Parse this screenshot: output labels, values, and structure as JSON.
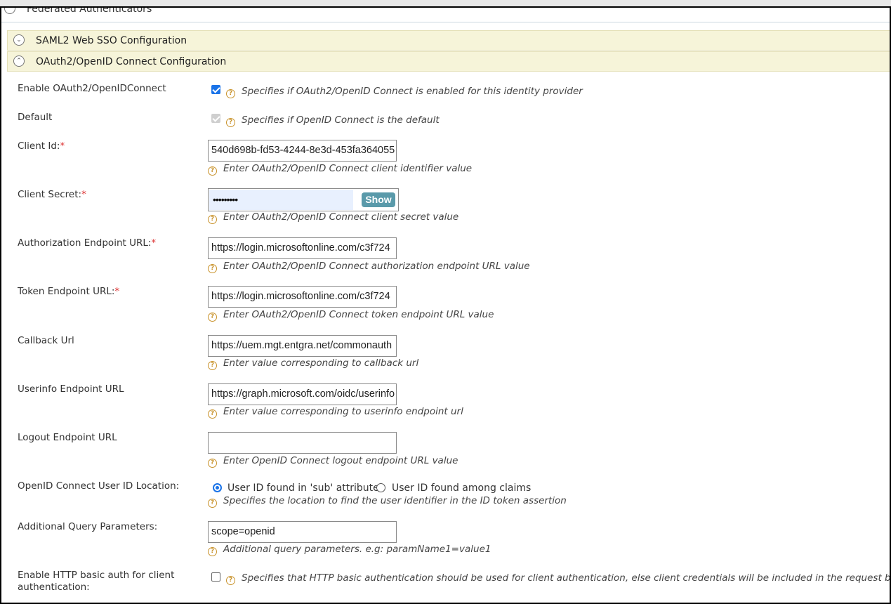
{
  "federated": {
    "title": "Federated Authenticators"
  },
  "sections": {
    "saml": "SAML2 Web SSO Configuration",
    "oauth": "OAuth2/OpenID Connect Configuration"
  },
  "required_marker": "*",
  "fields": {
    "enable": {
      "label": "Enable OAuth2/OpenIDConnect",
      "checked": true,
      "hint": "Specifies if OAuth2/OpenID Connect is enabled for this identity provider"
    },
    "default": {
      "label": "Default",
      "checked": true,
      "disabled": true,
      "hint": "Specifies if OpenID Connect is the default"
    },
    "client_id": {
      "label": "Client Id:",
      "value": "540d698b-fd53-4244-8e3d-453fa364055",
      "hint": "Enter OAuth2/OpenID Connect client identifier value"
    },
    "client_secret": {
      "label": "Client Secret:",
      "value": "•••••••••",
      "show_label": "Show",
      "hint": "Enter OAuth2/OpenID Connect client secret value"
    },
    "auth_endpoint": {
      "label": "Authorization Endpoint URL:",
      "value": "https://login.microsoftonline.com/c3f724",
      "hint": "Enter OAuth2/OpenID Connect authorization endpoint URL value"
    },
    "token_endpoint": {
      "label": "Token Endpoint URL:",
      "value": "https://login.microsoftonline.com/c3f724",
      "hint": "Enter OAuth2/OpenID Connect token endpoint URL value"
    },
    "callback_url": {
      "label": "Callback Url",
      "value": "https://uem.mgt.entgra.net/commonauth",
      "hint": "Enter value corresponding to callback url"
    },
    "userinfo_endpoint": {
      "label": "Userinfo Endpoint URL",
      "value": "https://graph.microsoft.com/oidc/userinfo",
      "hint": "Enter value corresponding to userinfo endpoint url"
    },
    "logout_endpoint": {
      "label": "Logout Endpoint URL",
      "value": "",
      "hint": "Enter OpenID Connect logout endpoint URL value"
    },
    "user_id_location": {
      "label": "OpenID Connect User ID Location:",
      "options": [
        "User ID found in 'sub' attribute",
        "User ID found among claims"
      ],
      "selected": 0,
      "hint": "Specifies the location to find the user identifier in the ID token assertion"
    },
    "query_params": {
      "label": "Additional Query Parameters:",
      "value": "scope=openid",
      "hint": "Additional query parameters. e.g: paramName1=value1"
    },
    "http_basic": {
      "label_line1": "Enable HTTP basic auth for client",
      "label_line2": "authentication:",
      "checked": false,
      "hint": "Specifies that HTTP basic authentication should be used for client authentication, else client credentials will be included in the request body"
    }
  },
  "icons": {
    "toggle_collapsed": "chevron-down-icon",
    "toggle_expanded": "chevron-up-icon",
    "help": "question-circle-icon"
  },
  "colors": {
    "section_bg": "#f6f4d9",
    "show_button": "#5a9aaa",
    "help_icon": "#c9932c",
    "required": "#d33333"
  }
}
